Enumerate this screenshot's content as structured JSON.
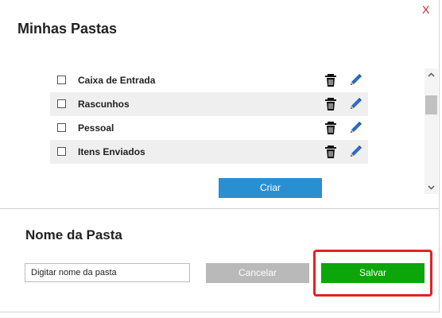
{
  "dialog": {
    "close_label": "X",
    "title": "Minhas Pastas"
  },
  "folders": [
    {
      "label": "Caixa de Entrada",
      "delete_icon": "trash-icon",
      "edit_icon": "pencil-icon"
    },
    {
      "label": "Rascunhos",
      "delete_icon": "trash-icon",
      "edit_icon": "pencil-icon"
    },
    {
      "label": "Pessoal",
      "delete_icon": "trash-icon",
      "edit_icon": "pencil-icon"
    },
    {
      "label": "Itens Enviados",
      "delete_icon": "trash-icon",
      "edit_icon": "pencil-icon"
    }
  ],
  "actions": {
    "create_label": "Criar"
  },
  "folder_name": {
    "section_title": "Nome da Pasta",
    "input_value": "Digitar nome da pasta",
    "cancel_label": "Cancelar",
    "save_label": "Salvar"
  },
  "colors": {
    "close": "#e02020",
    "create": "#2a8fd0",
    "cancel": "#b9b9b9",
    "save": "#0aa60a",
    "highlight": "#e32124"
  }
}
